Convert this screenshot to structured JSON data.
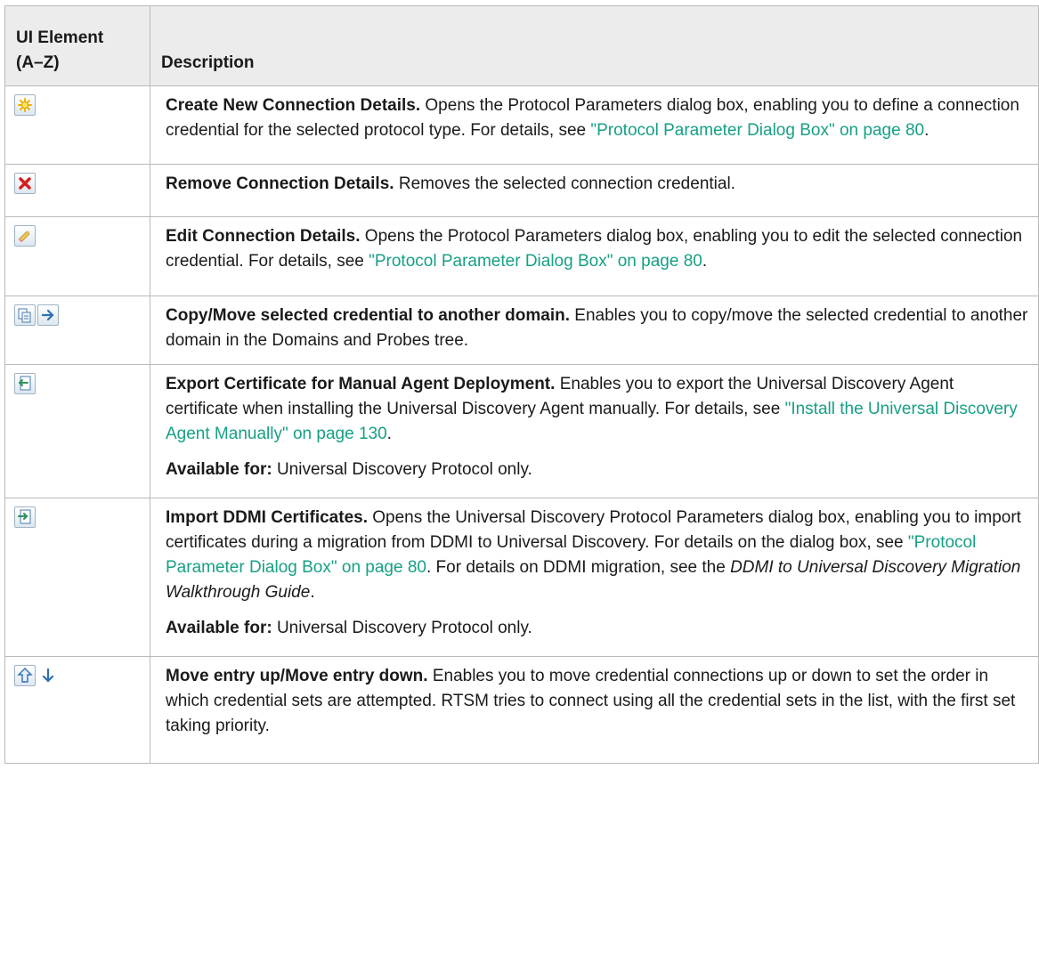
{
  "header": {
    "col1_line1": "UI Element",
    "col1_line2": "(A–Z)",
    "col2": "Description"
  },
  "rows": [
    {
      "icons": [
        "new-sparkle-icon"
      ],
      "title": "Create New Connection Details.",
      "text1": " Opens the Protocol Parameters dialog box, enabling you to define a connection credential for the selected protocol type. For details, see ",
      "link1": "\"Protocol Parameter Dialog Box\" on page 80",
      "end1": "."
    },
    {
      "icons": [
        "remove-x-icon"
      ],
      "title": "Remove Connection Details.",
      "text1": " Removes the selected connection credential."
    },
    {
      "icons": [
        "edit-pencil-icon"
      ],
      "title": "Edit Connection Details.",
      "text1": " Opens the Protocol Parameters dialog box, enabling you to edit the selected connection credential. For details, see ",
      "link1": "\"Protocol Parameter Dialog Box\" on page 80",
      "end1": "."
    },
    {
      "icons": [
        "copy-icon",
        "move-arrow-icon"
      ],
      "title": "Copy/Move selected credential to another domain.",
      "text1": " Enables you to copy/move the selected credential to another domain in the Domains and Probes tree."
    },
    {
      "icons": [
        "export-certificate-icon"
      ],
      "title": "Export Certificate for Manual Agent Deployment.",
      "text1": " Enables you to export the Universal Discovery Agent certificate when installing the Universal Discovery Agent manually. For details, see ",
      "link1": "\"Install the Universal Discovery Agent Manually\" on page 130",
      "end1": ".",
      "avail_label": "Available for:",
      "avail_text": " Universal Discovery Protocol only."
    },
    {
      "icons": [
        "import-certificate-icon"
      ],
      "title": "Import DDMI Certificates.",
      "text1": " Opens the Universal Discovery Protocol Parameters dialog box, enabling you to import certificates during a migration from DDMI to Universal Discovery. For details on the dialog box, see ",
      "link1": "\"Protocol Parameter Dialog Box\" on page 80",
      "mid1": ". For details on DDMI migration, see the ",
      "italic1": "DDMI to Universal Discovery Migration Walkthrough Guide",
      "end1": ".",
      "avail_label": "Available for:",
      "avail_text": " Universal Discovery Protocol only."
    },
    {
      "icons": [
        "move-up-icon",
        "move-down-icon"
      ],
      "title": "Move entry up/Move entry down.",
      "text1": " Enables you to move credential connections up or down to set the order in which credential sets are attempted. RTSM tries to connect using all the credential sets in the list, with the first set taking priority."
    }
  ],
  "colors": {
    "link": "#16a085",
    "header_bg": "#ececec",
    "border": "#b9b9b9"
  }
}
